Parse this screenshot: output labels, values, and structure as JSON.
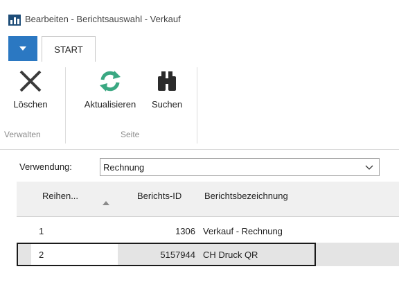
{
  "window": {
    "title": "Bearbeiten - Berichtsauswahl - Verkauf"
  },
  "ribbon": {
    "tab_start": "START",
    "groups": [
      {
        "label": "Verwalten",
        "buttons": [
          {
            "label": "Löschen",
            "icon": "delete-x-icon"
          }
        ]
      },
      {
        "label": "Seite",
        "buttons": [
          {
            "label": "Aktualisieren",
            "icon": "refresh-icon"
          },
          {
            "label": "Suchen",
            "icon": "binoculars-icon"
          }
        ]
      }
    ]
  },
  "filter": {
    "label": "Verwendung:",
    "value": "Rechnung"
  },
  "table": {
    "columns": [
      "Reihen...",
      "Berichts-ID",
      "Berichtsbezeichnung"
    ],
    "rows": [
      {
        "seq": "1",
        "id": "1306",
        "name": "Verkauf - Rechnung"
      },
      {
        "seq": "2",
        "id": "5157944",
        "name": "CH Druck QR"
      }
    ]
  },
  "colors": {
    "accent": "#2b78c2",
    "refresh_green": "#3aa882",
    "selected_row": "#e4e4e4"
  }
}
